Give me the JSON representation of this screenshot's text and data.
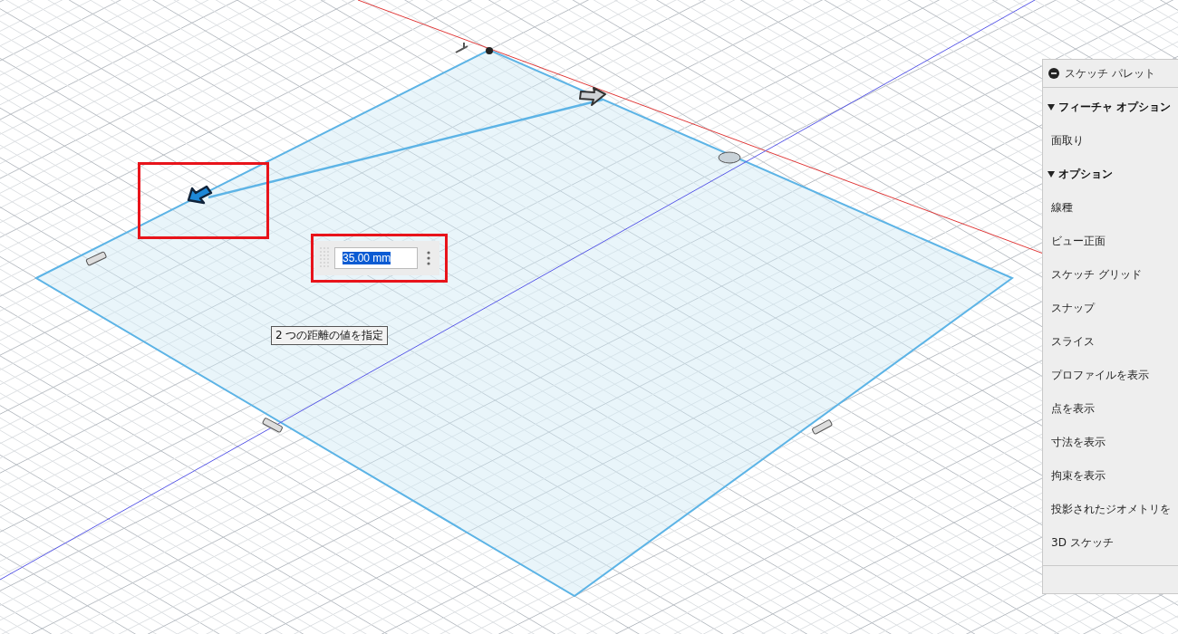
{
  "dimension_input": {
    "value": "35.00 mm",
    "selected": true
  },
  "tooltip": {
    "text": "2 つの距離の値を指定"
  },
  "sketch_palette": {
    "title": "スケッチ パレット",
    "sections": [
      {
        "label": "フィーチャ オプション",
        "expanded": true,
        "items": [
          "面取り"
        ]
      },
      {
        "label": "オプション",
        "expanded": true,
        "items": [
          "線種",
          "ビュー正面",
          "スケッチ グリッド",
          "スナップ",
          "スライス",
          "プロファイルを表示",
          "点を表示",
          "寸法を表示",
          "拘束を表示",
          "投影されたジオメトリを",
          "3D スケッチ"
        ]
      }
    ]
  }
}
